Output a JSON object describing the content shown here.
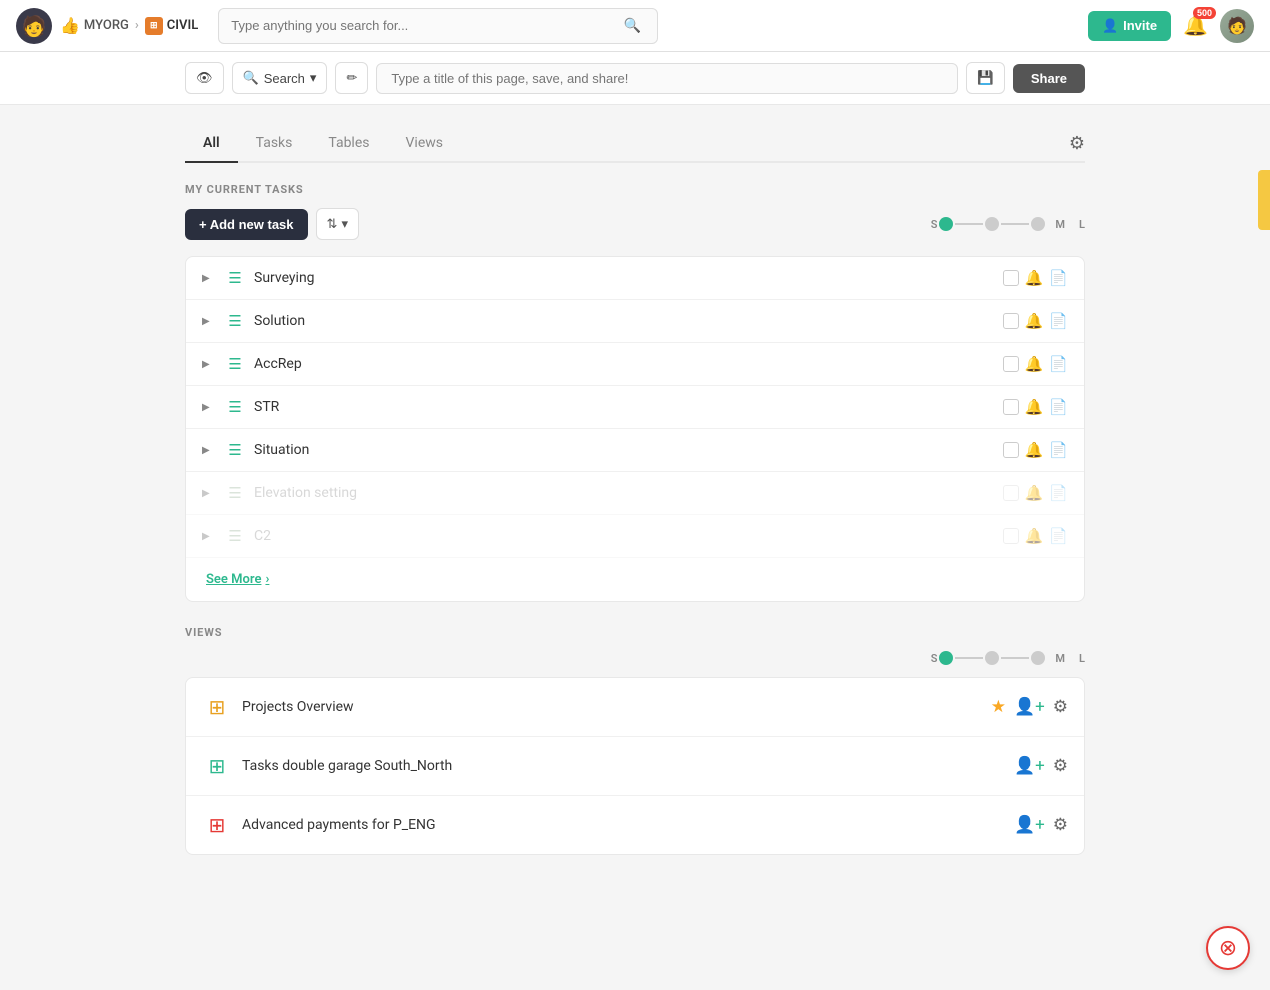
{
  "topnav": {
    "org_thumb": "👍",
    "org_name": "MYORG",
    "breadcrumb_sep": "›",
    "project_name": "CIVIL",
    "search_placeholder": "Type anything you search for...",
    "invite_label": "Invite",
    "notif_count": "500",
    "user_emoji": "🧑"
  },
  "toolbar": {
    "eye_icon": "👁",
    "search_label": "Search",
    "search_dropdown": "▾",
    "edit_icon": "✎",
    "page_title_placeholder": "Type a title of this page, save, and share!",
    "save_icon": "💾",
    "share_label": "Share"
  },
  "tabs": {
    "items": [
      {
        "label": "All",
        "active": true
      },
      {
        "label": "Tasks",
        "active": false
      },
      {
        "label": "Tables",
        "active": false
      },
      {
        "label": "Views",
        "active": false
      }
    ],
    "settings_icon": "⚙"
  },
  "my_tasks": {
    "section_label": "MY CURRENT TASKS",
    "add_task_label": "+ Add new task",
    "sort_icon": "⇅",
    "sort_dropdown": "▾",
    "size_labels": {
      "s": "S",
      "m": "M",
      "l": "L"
    },
    "tasks": [
      {
        "name": "Surveying",
        "dimmed": false
      },
      {
        "name": "Solution",
        "dimmed": false
      },
      {
        "name": "AccRep",
        "dimmed": false
      },
      {
        "name": "STR",
        "dimmed": false
      },
      {
        "name": "Situation",
        "dimmed": false
      },
      {
        "name": "Elevation setting",
        "dimmed": true
      },
      {
        "name": "C2",
        "dimmed": true
      }
    ],
    "see_more_label": "See More",
    "see_more_arrow": "›"
  },
  "views": {
    "section_label": "VIEWS",
    "size_labels": {
      "s": "S",
      "m": "M",
      "l": "L"
    },
    "items": [
      {
        "name": "Projects Overview",
        "icon_type": "yellow",
        "has_star": true
      },
      {
        "name": "Tasks double garage South_North",
        "icon_type": "green",
        "has_star": false
      },
      {
        "name": "Advanced payments for P_ENG",
        "icon_type": "red",
        "has_star": false
      }
    ]
  },
  "icons": {
    "task_list": "≡",
    "expand_arrow": "▶",
    "pin": "🔔",
    "doc": "📄",
    "star": "★",
    "people_plus": "👤+",
    "gear": "⚙",
    "grid_icon": "⊞"
  }
}
